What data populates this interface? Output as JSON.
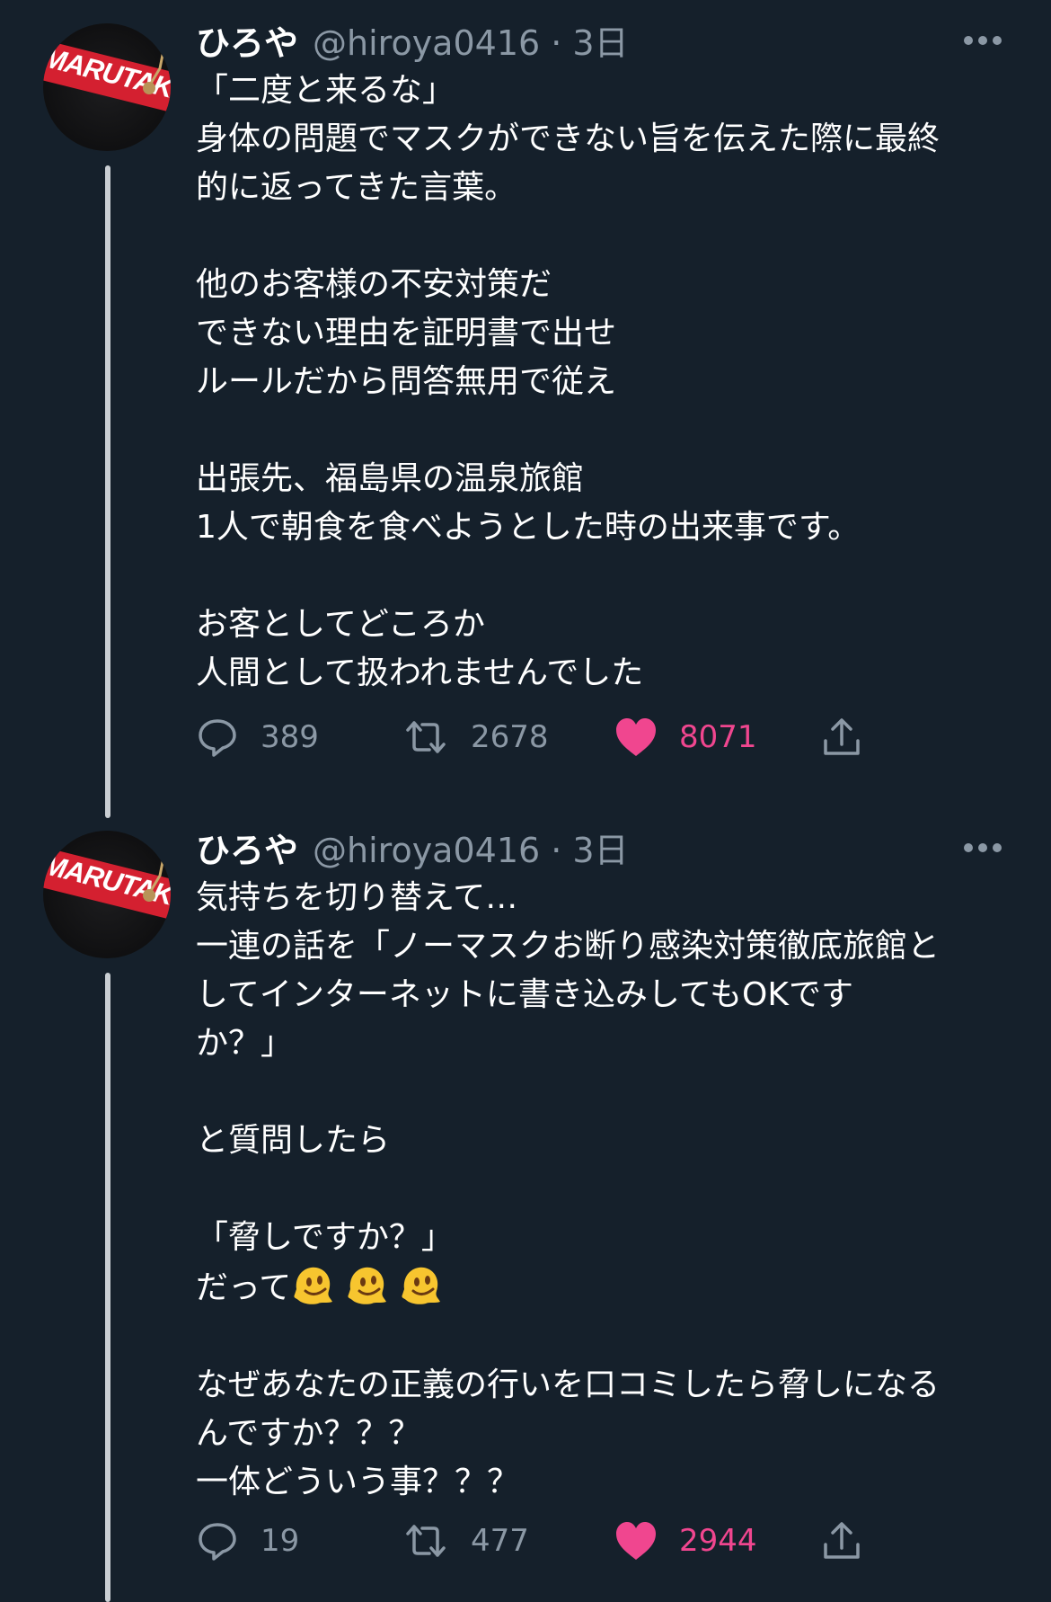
{
  "tweets": [
    {
      "display_name": "ひろや",
      "handle_time": "@hiroya0416 · 3日",
      "avatar_text": "MARUTAKA",
      "text": "「二度と来るな」\n身体の問題でマスクができない旨を伝えた際に最終\n的に返ってきた言葉。\n\n他のお客様の不安対策だ\nできない理由を証明書で出せ\nルールだから問答無用で従え\n\n出張先、福島県の温泉旅館\n1人で朝食を食べようとした時の出来事です。\n\nお客としてどころか\n人間として扱われませんでした",
      "replies": "389",
      "retweets": "2678",
      "likes": "8071"
    },
    {
      "display_name": "ひろや",
      "handle_time": "@hiroya0416 · 3日",
      "avatar_text": "MARUTAKA",
      "text": "気持ちを切り替えて…\n一連の話を「ノーマスクお断り感染対策徹底旅館と\nしてインターネットに書き込みしてもOKです\nか？」\n\nと質問したら\n\n「脅しですか？」",
      "text_dattе": "だって",
      "text_after": "\n\nなぜあなたの正義の行いを口コミしたら脅しになる\nんですか？？？\n一体どういう事？？？",
      "emoji": [
        "melting-face",
        "melting-face",
        "melting-face"
      ],
      "replies": "19",
      "retweets": "477",
      "likes": "2944"
    }
  ],
  "icons": {
    "reply": "reply-icon",
    "retweet": "retweet-icon",
    "like": "heart-icon",
    "share": "share-icon",
    "more": "more-icon"
  },
  "colors": {
    "background": "#15202b",
    "secondary_text": "#8b98a5",
    "like": "#f0468f",
    "avatar_band": "#d42030"
  }
}
